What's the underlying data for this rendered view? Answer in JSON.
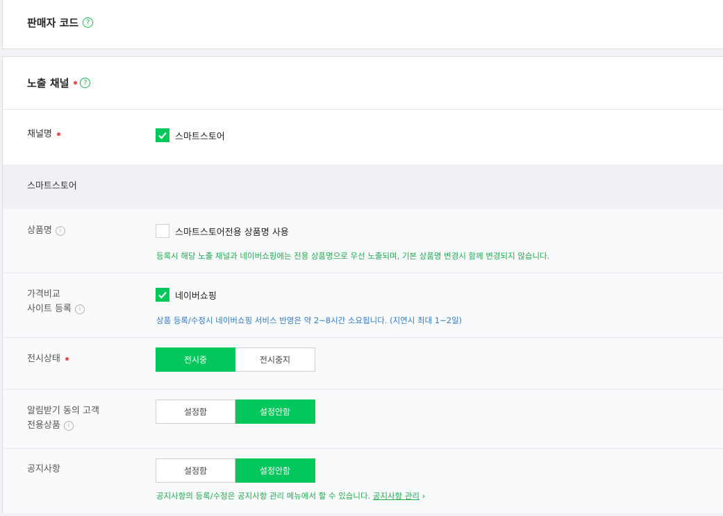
{
  "seller_code": {
    "title": "판매자 코드",
    "help_icon": "?"
  },
  "exposure_channel": {
    "title": "노출 채널",
    "help_icon": "?",
    "channel_name_label": "채널명",
    "smartstore_checkbox_label": "스마트스토어",
    "smartstore_checked": true
  },
  "smartstore_section": {
    "header": "스마트스토어",
    "product_name": {
      "label": "상품명",
      "info_icon": "i",
      "checkbox_label": "스마트스토어전용 상품명 사용",
      "checked": false,
      "hint": "등록시 해당 노출 채널과 네이버쇼핑에는 전용 상품명으로 우선 노출되며, 기본 상품명 변경시 함께 변경되지 않습니다."
    },
    "price_compare": {
      "label_line1": "가격비교",
      "label_line2": "사이트 등록",
      "info_icon": "i",
      "checkbox_label": "네이버쇼핑",
      "checked": true,
      "hint": "상품 등록/수정시 네이버쇼핑 서비스 반영은 약 2~8시간 소요됩니다. (지연시 최대 1~2일)"
    },
    "display_status": {
      "label": "전시상태",
      "options": [
        "전시중",
        "전시중지"
      ],
      "selected": "전시중"
    },
    "notify_exclusive": {
      "label_line1": "알림받기 동의 고객",
      "label_line2": "전용상품",
      "info_icon": "i",
      "options": [
        "설정함",
        "설정안함"
      ],
      "selected": "설정안함"
    },
    "notice": {
      "label": "공지사항",
      "options": [
        "설정함",
        "설정안함"
      ],
      "selected": "설정안함",
      "hint": "공지사항의 등록/수정은 공지사항 관리 메뉴에서 할 수 있습니다.",
      "hint_link": "공지사항 관리",
      "hint_link_arrow": "›"
    }
  },
  "colors": {
    "accent_green": "#03c75a",
    "required_dot": "#f3474a",
    "hint_green": "#21a84d",
    "hint_blue": "#2f79c6"
  }
}
